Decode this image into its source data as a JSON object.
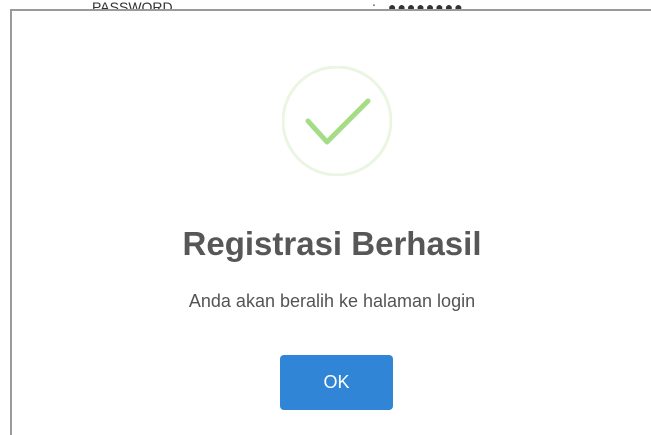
{
  "background": {
    "field_label": "PASSWORD",
    "separator": ":",
    "password_mask": "●●●●●●●●"
  },
  "dialog": {
    "icon": "success-check-icon",
    "title": "Registrasi Berhasil",
    "message": "Anda akan beralih ke halaman login",
    "ok_label": "OK"
  },
  "colors": {
    "accent": "#3085d6",
    "success_ring": "#eaf6e1",
    "success_check": "#a5dc86",
    "title_text": "#575757"
  }
}
